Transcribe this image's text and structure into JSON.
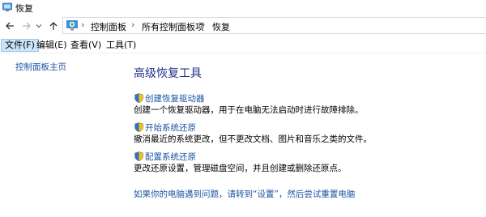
{
  "window": {
    "title": "恢复",
    "icon": "recovery-app-icon"
  },
  "navigation": {
    "back_icon": "arrow-left-icon",
    "forward_icon": "arrow-right-icon",
    "recent_icon": "chevron-down-icon",
    "up_icon": "arrow-up-icon",
    "breadcrumbs": [
      "控制面板",
      "所有控制面板项",
      "恢复"
    ]
  },
  "menubar": {
    "items": [
      "文件(F)",
      "编辑(E)",
      "查看(V)",
      "工具(T)"
    ],
    "active_index": 0
  },
  "sidebar": {
    "home_link": "控制面板主页"
  },
  "main": {
    "heading": "高级恢复工具",
    "tasks": [
      {
        "label": "创建恢复驱动器",
        "description": "创建一个恢复驱动器，用于在电脑无法启动时进行故障排除。",
        "icon": "uac-shield-icon"
      },
      {
        "label": "开始系统还原",
        "description": "撤消最近的系统更改，但不更改文档、图片和音乐之类的文件。",
        "icon": "uac-shield-icon"
      },
      {
        "label": "配置系统还原",
        "description": "更改还原设置，管理磁盘空间，并且创建或删除还原点。",
        "icon": "uac-shield-icon"
      }
    ],
    "footer_link": "如果你的电脑遇到问题，请转到“设置”，然后尝试重置电脑"
  },
  "colors": {
    "link": "#1c55a3",
    "heading": "#1e3287",
    "menu_active_bg": "#cce4f7"
  }
}
